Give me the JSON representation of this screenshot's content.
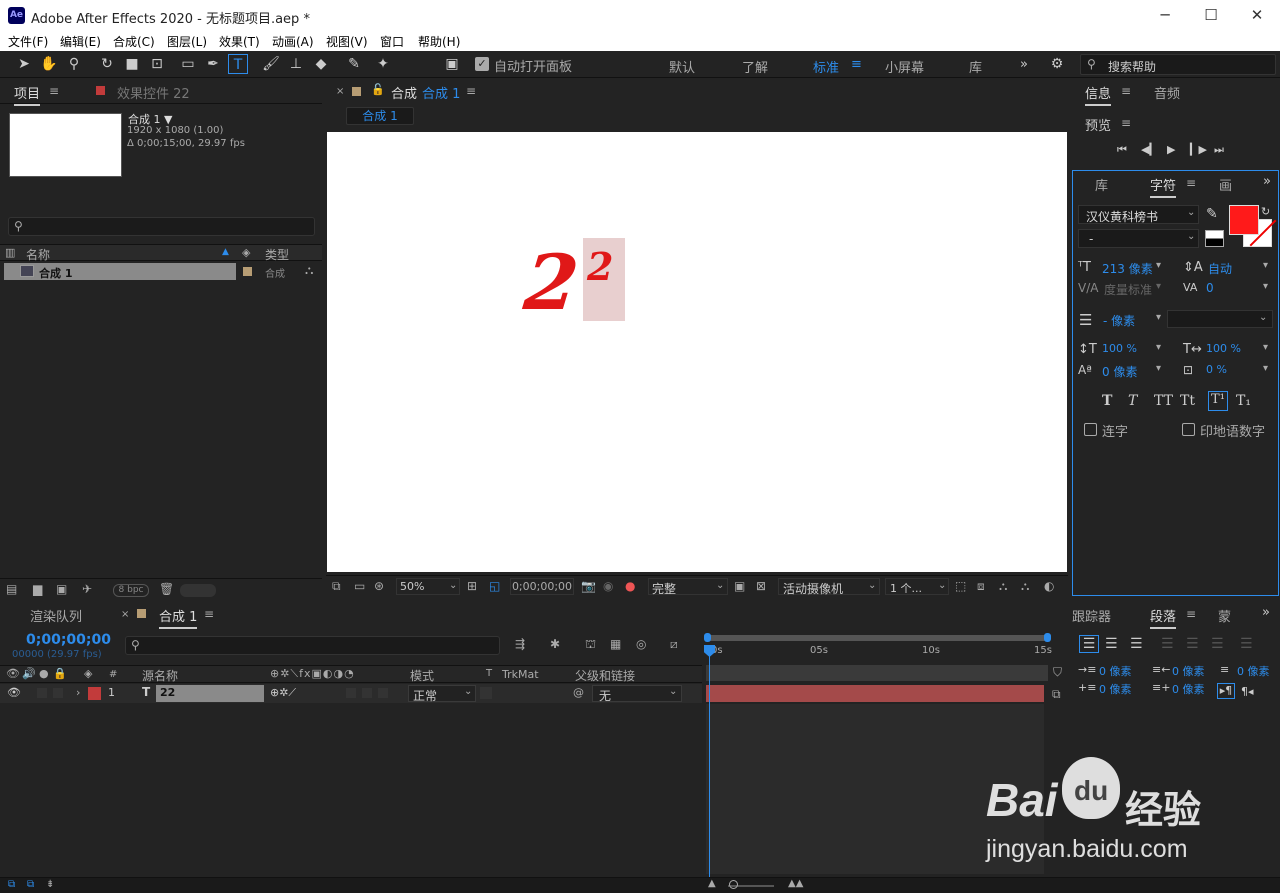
{
  "window": {
    "title": "Adobe After Effects 2020 - 无标题项目.aep *",
    "logo": "Ae",
    "min": "─",
    "max": "☐",
    "close": "✕"
  },
  "menu": [
    "文件(F)",
    "编辑(E)",
    "合成(C)",
    "图层(L)",
    "效果(T)",
    "动画(A)",
    "视图(V)",
    "窗口",
    "帮助(H)"
  ],
  "toolbar": {
    "auto_open_label": "自动打开面板",
    "workspaces": [
      "默认",
      "了解",
      "标准",
      "小屏幕",
      "库"
    ],
    "active_workspace": "标准",
    "search_placeholder": "搜索帮助",
    "more": "»"
  },
  "project": {
    "tab_project": "项目",
    "tab_effects": "效果控件 22",
    "comp_name": "合成 1 ▼",
    "comp_info1": "1920 x 1080 (1.00)",
    "comp_info2": "Δ 0;00;15;00, 29.97 fps",
    "col_name": "名称",
    "col_type": "类型",
    "items": [
      {
        "name": "合成 1",
        "type": "合成"
      }
    ],
    "bpc": "8 bpc"
  },
  "composition": {
    "tab_label": "合成",
    "tab_name": "合成 1",
    "breadcrumb": "合成 1",
    "text_big": "2",
    "text_small": "2",
    "zoom": "50%",
    "timecode": "0;00;00;00",
    "resolution": "完整",
    "camera": "活动摄像机",
    "views": "1 个..."
  },
  "info_panel": {
    "tab_info": "信息",
    "tab_audio": "音频",
    "preview": "预览",
    "controls": [
      "⏮",
      "◀▎",
      "▶",
      "▎▶",
      "⏭"
    ]
  },
  "character": {
    "tab_lib": "库",
    "tab_char": "字符",
    "tab_para": "画",
    "font": "汉仪黄科榜书",
    "style": "-",
    "size": "213 像素",
    "leading": "自动",
    "kerning": "度量标准",
    "tracking": "0",
    "stroke": "- 像素",
    "vscale": "100 %",
    "hscale": "100 %",
    "baseline": "0 像素",
    "tsume": "0 %",
    "styles": [
      "T",
      "T",
      "TT",
      "Tt",
      "T¹",
      "T₁"
    ],
    "ligatures": "连字",
    "hindi": "印地语数字",
    "fill_color": "#ff1a1a"
  },
  "timeline": {
    "tab_render": "渲染队列",
    "tab_comp": "合成 1",
    "timecode": "0;00;00;00",
    "frames": "00000 (29.97 fps)",
    "cols": {
      "hash": "#",
      "source": "源名称",
      "mode": "模式",
      "t": "T",
      "trkmat": "TrkMat",
      "parent": "父级和链接"
    },
    "layer": {
      "index": "1",
      "type": "T",
      "name": "22",
      "mode": "正常",
      "parent": "无"
    },
    "ruler": [
      "0s",
      "05s",
      "10s",
      "15s"
    ],
    "bar_color": "#a44a4a"
  },
  "right_bottom": {
    "tab_tracker": "跟踪器",
    "tab_para": "段落",
    "tab_more": "蒙",
    "indent": [
      "0 像素",
      "0 像素",
      "0 像素",
      "0 像素",
      "0 像素"
    ]
  },
  "watermark": {
    "brand": "Bai",
    "du": "du",
    "jy": "经验",
    "url": "jingyan.baidu.com"
  }
}
